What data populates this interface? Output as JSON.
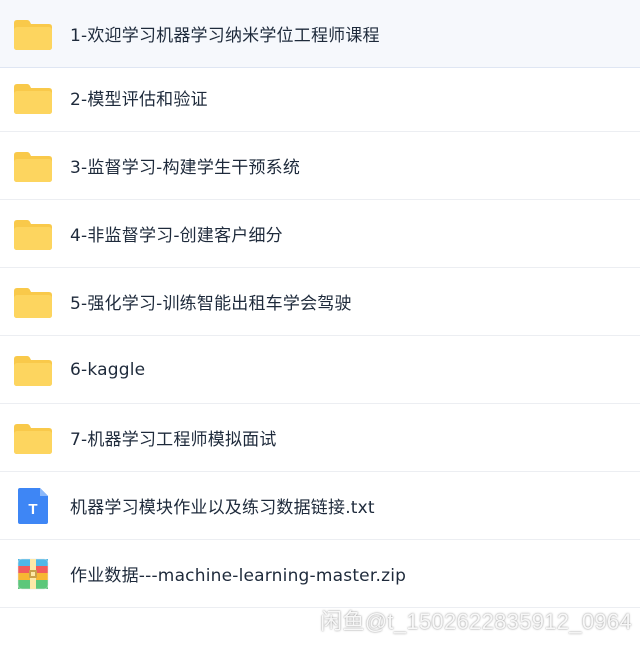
{
  "colors": {
    "folder": "#FDD55F",
    "folder_tab": "#F9C94A",
    "txt_icon": "#3E86F5",
    "row_selected_bg": "#f6f8fc",
    "divider": "#eceef2"
  },
  "items": [
    {
      "label": "1-欢迎学习机器学习纳米学位工程师课程",
      "icon": "folder-icon"
    },
    {
      "label": "2-模型评估和验证",
      "icon": "folder-icon"
    },
    {
      "label": "3-监督学习-构建学生干预系统",
      "icon": "folder-icon"
    },
    {
      "label": "4-非监督学习-创建客户细分",
      "icon": "folder-icon"
    },
    {
      "label": "5-强化学习-训练智能出租车学会驾驶",
      "icon": "folder-icon"
    },
    {
      "label": "6-kaggle",
      "icon": "folder-icon"
    },
    {
      "label": "7-机器学习工程师模拟面试",
      "icon": "folder-icon"
    },
    {
      "label": "机器学习模块作业以及练习数据链接.txt",
      "icon": "text-file-icon",
      "icon_letter": "T"
    },
    {
      "label": "作业数据---machine-learning-master.zip",
      "icon": "zip-file-icon"
    }
  ],
  "watermark": "闲鱼@t_1502622835912_0964"
}
